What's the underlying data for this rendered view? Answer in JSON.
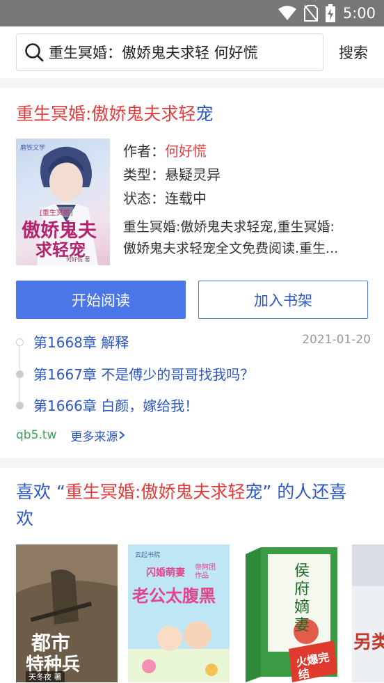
{
  "status_bar": {
    "time": "5:00",
    "icons": [
      "wifi-icon",
      "no-sim-icon",
      "battery-charging-icon"
    ]
  },
  "search": {
    "query": "重生冥婚：傲娇鬼夫求轻 何好慌",
    "button_label": "搜索"
  },
  "book": {
    "title_main": "重生冥婚:傲娇鬼夫求轻",
    "title_tail": "宠",
    "cover": {
      "publisher": "磨铁文学",
      "series_tag": "[重生冥婚]",
      "title_line1": "傲娇鬼夫",
      "title_line2": "求轻宠",
      "author_caption": "何好慌 著"
    },
    "author_label": "作者：",
    "author": "何好慌",
    "type_label": "类型：",
    "type": "悬疑灵异",
    "status_label": "状态：",
    "status": "连载中",
    "desc_line1": "重生冥婚:傲娇鬼夫求轻宠,重生冥婚:",
    "desc_line2": "傲娇鬼夫求轻宠全文免费阅读.重生..."
  },
  "actions": {
    "read_label": "开始阅读",
    "shelf_label": "加入书架"
  },
  "chapters": [
    {
      "title": "第1668章 解释",
      "date": "2021-01-20"
    },
    {
      "title": "第1667章 不是傅少的哥哥找我吗？"
    },
    {
      "title": "第1666章 白颜，嫁给我！"
    }
  ],
  "source": {
    "site": "qb5.tw",
    "more_label": "更多来源"
  },
  "recommend": {
    "prefix": "喜欢 “",
    "book_main": "重生冥婚:傲娇鬼夫求轻",
    "book_tail": "宠",
    "suffix": "” 的人还喜欢",
    "books": [
      {
        "cover_title_line1": "都市",
        "cover_title_line2": "特种兵",
        "cover_author": "天冬夜 著"
      },
      {
        "cover_title": "老公太腹黑",
        "cover_subtitle": "闪婚萌妻",
        "cover_publisher": "云起书院",
        "cover_badge": "帝阿团 作品"
      },
      {
        "cover_title": "侯府嫡妻",
        "cover_badge": "火爆完结"
      },
      {
        "cover_title": "另类"
      }
    ]
  },
  "colors": {
    "accent_red": "#e23c3c",
    "accent_blue": "#2a56c6",
    "button_blue": "#4a76e8",
    "source_green": "#3aa05a"
  }
}
